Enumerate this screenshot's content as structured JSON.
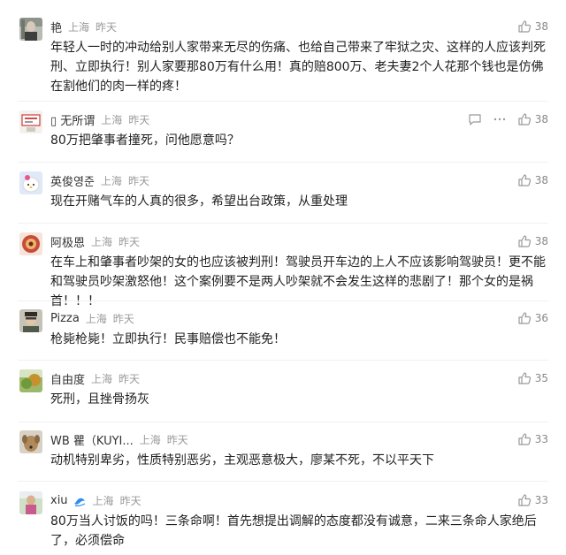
{
  "comments": [
    {
      "name": "艳",
      "location": "上海",
      "time": "昨天",
      "likes": "38",
      "text": "年轻人一时的冲动给别人家带来无尽的伤痛、也给自己带来了牢狱之灾、这样的人应该判死刑、立即执行！别人家要那80万有什么用！真的赔800万、老夫妻2个人花那个钱也是仿佛在割他们的肉一样的疼！",
      "avatar_icon": "avatar-photo-icon"
    },
    {
      "name": "▯ 无所谓",
      "location": "上海",
      "time": "昨天",
      "likes": "38",
      "text": "80万把肇事者撞死，问他愿意吗？",
      "avatar_icon": "avatar-sign-icon",
      "reply_icon": "reply-icon",
      "more_icon": "more-icon"
    },
    {
      "name": "英俊영준",
      "location": "上海",
      "time": "昨天",
      "likes": "38",
      "text": "现在开赌气车的人真的很多，希望出台政策，从重处理",
      "avatar_icon": "avatar-cartoon-icon"
    },
    {
      "name": "阿极恩",
      "location": "上海",
      "time": "昨天",
      "likes": "38",
      "text": "在车上和肇事者吵架的女的也应该被判刑！驾驶员开车边的上人不应该影响驾驶员！更不能和驾驶员吵架激怒他！这个案例要不是两人吵架就不会发生这样的悲剧了！那个女的是祸首！！！",
      "avatar_icon": "avatar-ornament-icon"
    },
    {
      "name": "Pizza",
      "location": "上海",
      "time": "昨天",
      "likes": "36",
      "text": "枪毙枪毙！立即执行！民事赔偿也不能免！",
      "avatar_icon": "avatar-person-icon"
    },
    {
      "name": "自由度",
      "location": "上海",
      "time": "昨天",
      "likes": "35",
      "text": "死刑，且挫骨扬灰",
      "avatar_icon": "avatar-landscape-icon"
    },
    {
      "name": "WB 瞿（KUYI...",
      "location": "上海",
      "time": "昨天",
      "likes": "33",
      "text": "动机特别卑劣，性质特别恶劣，主观恶意极大，廖某不死，不以平天下",
      "avatar_icon": "avatar-dog-icon"
    },
    {
      "name": "xiu",
      "location": "上海",
      "time": "昨天",
      "likes": "33",
      "text": "80万当人讨饭的吗！三条命啊！首先想提出调解的态度都没有诚意，二来三条命人家绝后了，必须偿命",
      "avatar_icon": "avatar-person-icon",
      "badge_icon": "wave-badge-icon"
    }
  ],
  "like_icon": "thumbs-up-icon",
  "colors": {
    "meta_gray": "#999999",
    "badge_blue": "#2f8cf0"
  }
}
